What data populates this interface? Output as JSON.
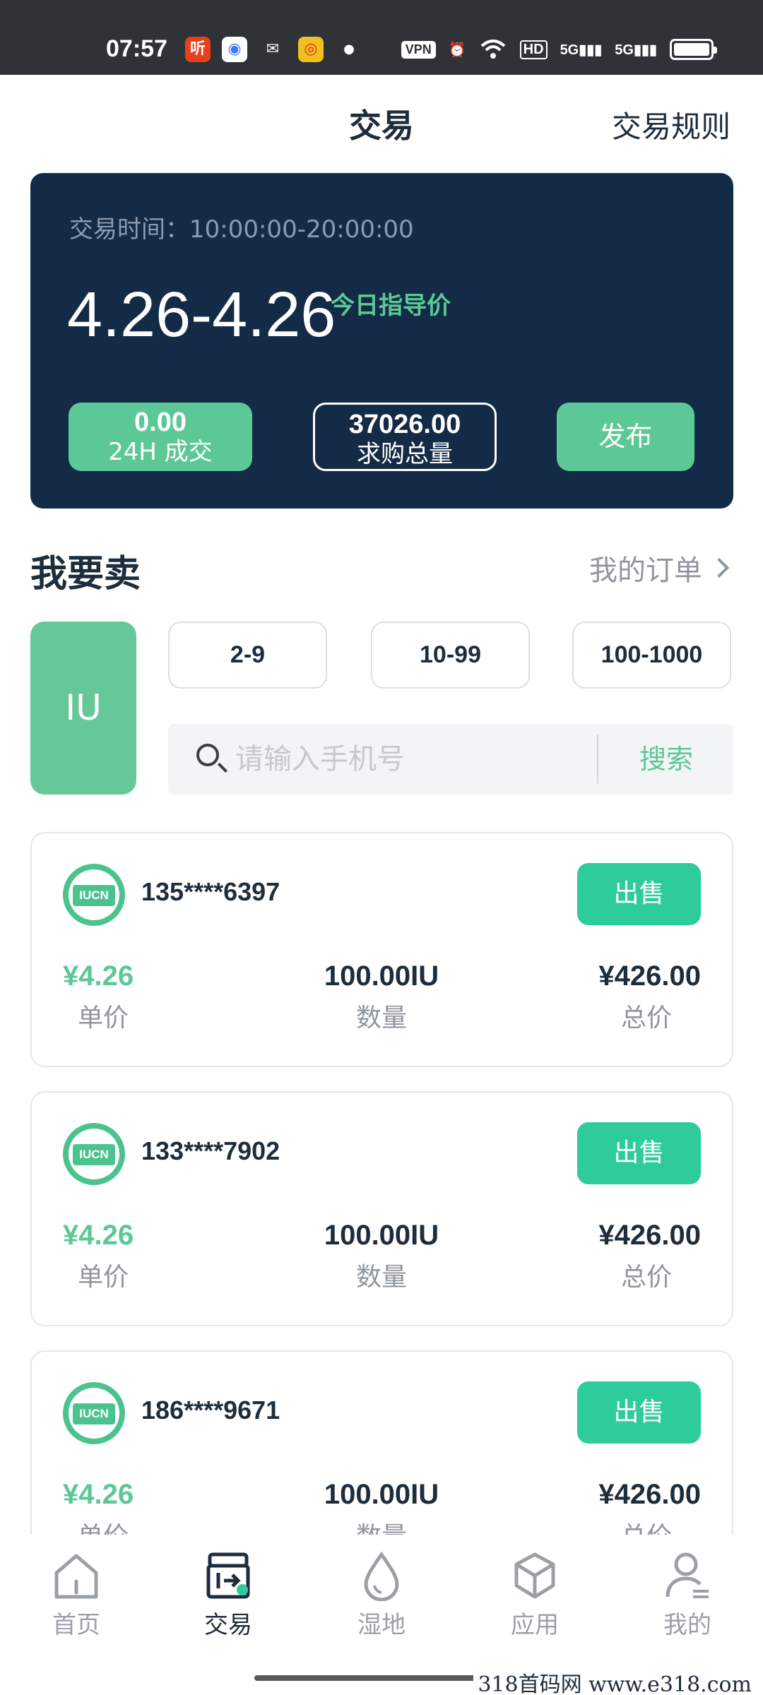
{
  "status_bar": {
    "time": "07:57",
    "vpn": "VPN",
    "hd": "HD",
    "signal1": "5G",
    "signal2": "5G"
  },
  "header": {
    "title": "交易",
    "rules_link": "交易规则"
  },
  "hero": {
    "trade_time": "交易时间：10:00:00-20:00:00",
    "price_range": "4.26-4.26",
    "guide_label": "今日指导价",
    "stat_24h_value": "0.00",
    "stat_24h_label": "24H 成交",
    "stat_demand_value": "37026.00",
    "stat_demand_label": "求购总量",
    "publish_label": "发布"
  },
  "sell_section": {
    "title": "我要卖",
    "my_orders": "我的订单",
    "unit_tab": "IU",
    "ranges": [
      "2-9",
      "10-99",
      "100-1000"
    ],
    "search_placeholder": "请输入手机号",
    "search_button": "搜索"
  },
  "orders": [
    {
      "phone": "135****6397",
      "unit_price": "¥4.26",
      "quantity": "100.00IU",
      "total": "¥426.00"
    },
    {
      "phone": "133****7902",
      "unit_price": "¥4.26",
      "quantity": "100.00IU",
      "total": "¥426.00"
    },
    {
      "phone": "186****9671",
      "unit_price": "¥4.26",
      "quantity": "100.00IU",
      "total": "¥426.00"
    }
  ],
  "order_labels": {
    "logo": "IUCN",
    "sell_button": "出售",
    "unit_price": "单价",
    "quantity": "数量",
    "total": "总价"
  },
  "tabbar": {
    "items": [
      {
        "label": "首页",
        "icon": "home-icon"
      },
      {
        "label": "交易",
        "icon": "trade-icon"
      },
      {
        "label": "湿地",
        "icon": "droplet-icon"
      },
      {
        "label": "应用",
        "icon": "cube-icon"
      },
      {
        "label": "我的",
        "icon": "user-icon"
      }
    ]
  },
  "watermark": "318首码网  www.e318.com",
  "colors": {
    "accent": "#5cc896",
    "hero_bg": "#142b47",
    "sell_button": "#2ecc9a",
    "text_dark": "#1e2d3c"
  }
}
